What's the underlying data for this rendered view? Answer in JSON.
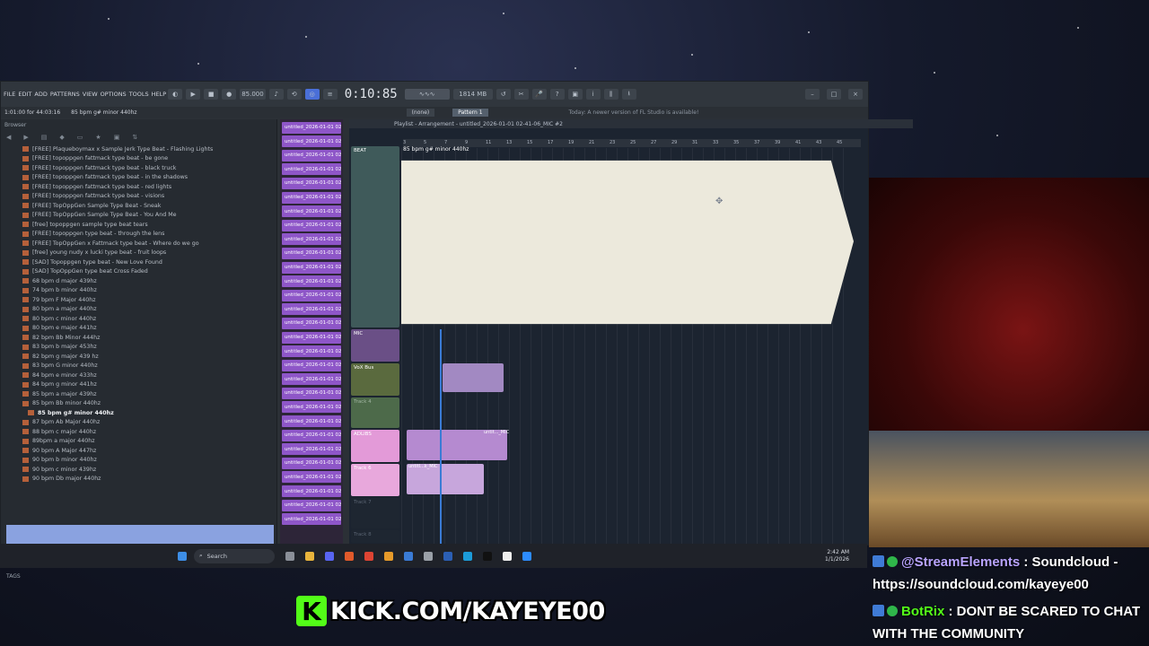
{
  "fl": {
    "menu": [
      "FILE",
      "EDIT",
      "ADD",
      "PATTERNS",
      "VIEW",
      "OPTIONS",
      "TOOLS",
      "HELP"
    ],
    "tempo": "85.000",
    "time": "0:10:85",
    "pattern": "Pattern 1",
    "snap": "(none)",
    "cpu": "1814 MB",
    "update_notice": "Today: A newer version of FL Studio is available!",
    "hint": "1:01:00 for 44:03:16",
    "hint2": "85 bpm g# minor 440hz",
    "playlist_title": "Playlist - Arrangement - untitled_2026-01-01 02-41-06_MIC #2",
    "browser_label": "Browser"
  },
  "browser": {
    "items": [
      "[FREE] Plaqueboymax x Sample Jerk Type Beat - Flashing Lights",
      "[FREE] topoppgen fattmack type beat - be gone",
      "[FREE] topoppgen fattmack type beat - black truck",
      "[FREE] topoppgen fattmack type beat - in the shadows",
      "[FREE] topoppgen fattmack type beat - red lights",
      "[FREE] topoppgen fattmack type beat - visions",
      "[FREE] TopOppGen Sample Type Beat - Sneak",
      "[FREE] TopOppGen Sample Type Beat - You And Me",
      "[free] topoppgen sample type beat tears",
      "[FREE] topoppgen type beat - through the lens",
      "[FREE] TopOppGen x Fattmack type beat - Where do we go",
      "[free] young nudy x lucki type beat - fruit loops",
      "[SAD] Topoppgen type beat - New Love Found",
      "[SAD] TopOppGen type beat Cross Faded",
      "68 bpm d major 439hz",
      "74 bpm b minor 440hz",
      "79 bpm F Major 440hz",
      "80 bpm a major 440hz",
      "80 bpm c minor 440hz",
      "80 bpm e major 441hz",
      "82 bpm Bb Minor 444hz",
      "83 bpm b major 453hz",
      "82 bpm g major 439 hz",
      "83 bpm G minor 440hz",
      "84 bpm e minor 433hz",
      "84 bpm g minor 441hz",
      "85 bpm a major 439hz",
      "85 bpm Bb minor 440hz",
      "85 bpm g# minor 440hz",
      "87 bpm Ab Major 440hz",
      "88 bpm c major 440hz",
      "89bpm a major 440hz",
      "90 bpm A Major 447hz",
      "90 bpm b minor 440hz",
      "90 bpm c minor 439hz",
      "90 bpm Db major 440hz"
    ],
    "selected_index": 28,
    "tags_label": "TAGS"
  },
  "cliplist": {
    "clip_label": "untitled_2026-01-01 02-..."
  },
  "playlist": {
    "tracks": [
      "BEAT",
      "MIC",
      "VoX Bus",
      "Track 4",
      "ADLIBS",
      "Track 6",
      "Track 7",
      "Track 8"
    ],
    "beat_clip": "85 bpm g# minor 440hz",
    "ruler": [
      "3",
      "5",
      "7",
      "9",
      "11",
      "13",
      "15",
      "17",
      "19",
      "21",
      "23",
      "25",
      "27",
      "29",
      "31",
      "33",
      "35",
      "37",
      "39",
      "41",
      "43",
      "45"
    ],
    "adlib_clip": "untit..._MIC",
    "track6_clip": "untitl...k_MIC"
  },
  "taskbar": {
    "search": "Search",
    "time": "2:42 AM",
    "date": "1/1/2026"
  },
  "chat": [
    {
      "user": "@StreamElements",
      "text": " : Soundcloud - https://soundcloud.com/kayeye00",
      "user_color": "#b9a4ff"
    },
    {
      "user": "BotRix",
      "text": " : DONT BE SCARED TO CHAT WITH THE COMMUNITY",
      "user_color": "#53fc18"
    }
  ],
  "kick": {
    "logo": "K",
    "url": "KICK.COM/KAYEYE00"
  }
}
